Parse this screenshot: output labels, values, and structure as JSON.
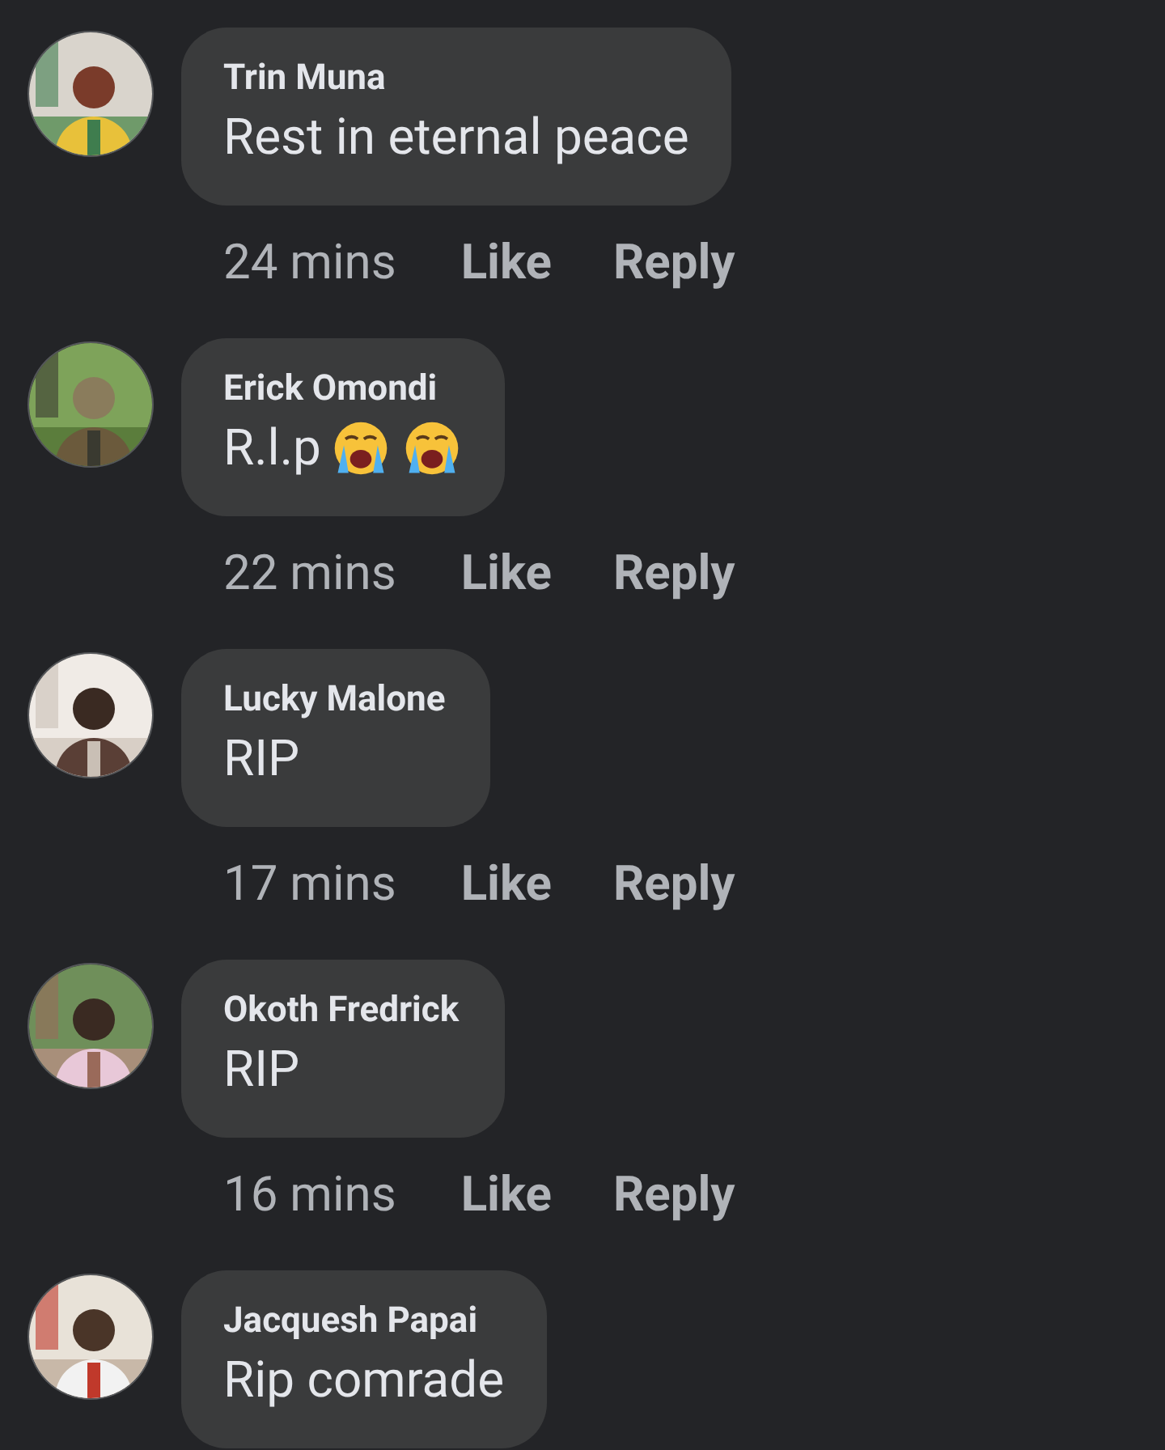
{
  "comments": [
    {
      "author": "Trin Muna",
      "text": "Rest in eternal peace",
      "time": "24 mins",
      "like": "Like",
      "reply": "Reply"
    },
    {
      "author": "Erick Omondi",
      "text": "R.l.p",
      "emojis": [
        {
          "kind": "crying"
        },
        {
          "kind": "crying"
        }
      ],
      "time": "22 mins",
      "like": "Like",
      "reply": "Reply"
    },
    {
      "author": "Lucky Malone",
      "text": "RIP",
      "time": "17 mins",
      "like": "Like",
      "reply": "Reply"
    },
    {
      "author": "Okoth Fredrick",
      "text": "RIP",
      "time": "16 mins",
      "like": "Like",
      "reply": "Reply"
    },
    {
      "author": "Jacquesh Papai",
      "text": "Rip comrade"
    }
  ]
}
